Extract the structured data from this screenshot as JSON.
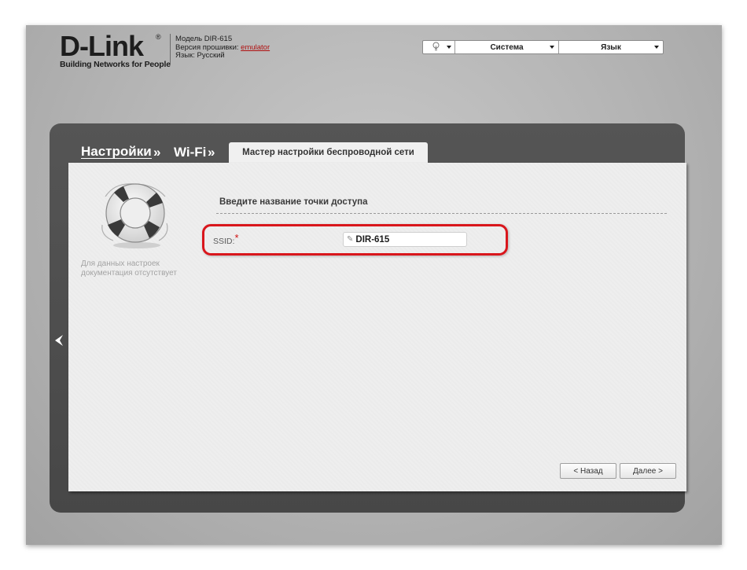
{
  "header": {
    "brand": "D-Link",
    "brand_mark": "®",
    "tagline": "Building Networks for People",
    "model_line": "Модель DIR-615",
    "firmware_prefix": "Версия прошивки: ",
    "firmware_link": "emulator",
    "language_line": "Язык: Русский"
  },
  "topbar": {
    "bulb_icon": "lightbulb-icon",
    "system_label": "Система",
    "language_label": "Язык"
  },
  "breadcrumb": {
    "settings": "Настройки",
    "sep": "»",
    "wifi": "Wi-Fi",
    "active_tab": "Мастер настройки беспроводной сети"
  },
  "help": {
    "icon": "lifebuoy-icon",
    "text": "Для данных настроек документация отсутствует"
  },
  "form": {
    "section_title": "Введите название точки доступа",
    "ssid_label": "SSID:",
    "required_mark": "*",
    "ssid_value": "DIR-615"
  },
  "buttons": {
    "back": "< Назад",
    "next": "Далее >"
  },
  "colors": {
    "highlight": "#d9161c",
    "panel": "#4d4d4d",
    "content_bg": "#eeeeee",
    "required": "#d01010",
    "firmware_link": "#b01010"
  }
}
